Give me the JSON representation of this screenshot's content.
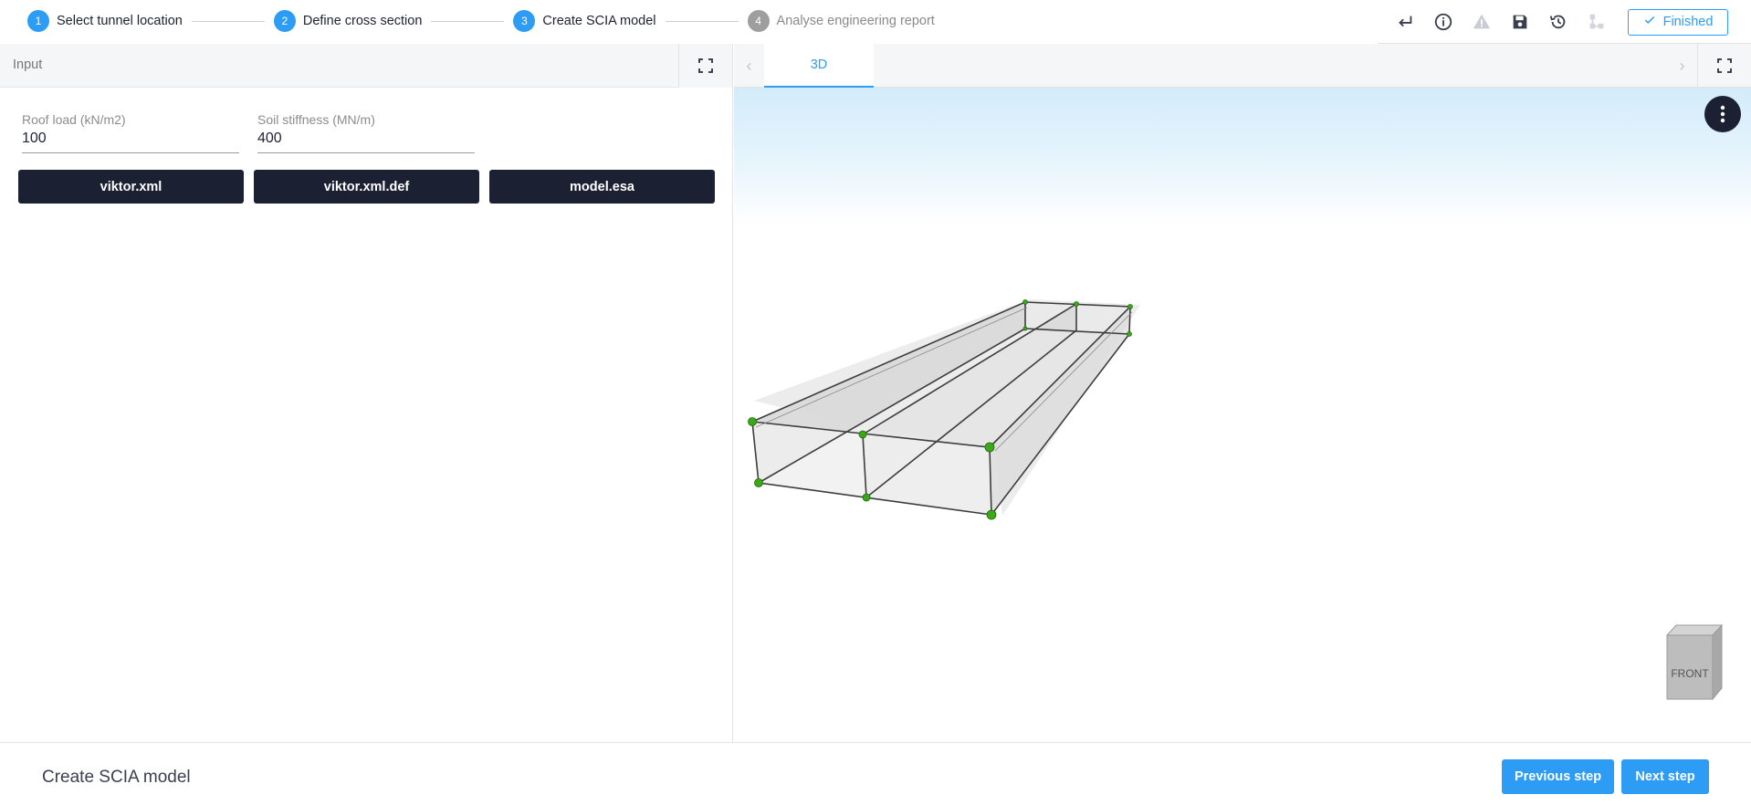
{
  "stepper": {
    "steps": [
      {
        "number": "1",
        "label": "Select tunnel location",
        "state": "done"
      },
      {
        "number": "2",
        "label": "Define cross section",
        "state": "done"
      },
      {
        "number": "3",
        "label": "Create SCIA model",
        "state": "active"
      },
      {
        "number": "4",
        "label": "Analyse engineering report",
        "state": "inactive"
      }
    ]
  },
  "toolbar": {
    "icons": [
      "enter-icon",
      "info-icon",
      "warning-icon",
      "save-icon",
      "history-icon",
      "hierarchy-icon"
    ],
    "finished_label": "Finished"
  },
  "input_panel": {
    "title": "Input",
    "fields": [
      {
        "label": "Roof load (kN/m2)",
        "value": "100"
      },
      {
        "label": "Soil stiffness (MN/m)",
        "value": "400"
      }
    ],
    "download_buttons": [
      "viktor.xml",
      "viktor.xml.def",
      "model.esa"
    ]
  },
  "viewer": {
    "tabs": [
      "3D"
    ],
    "active_tab": "3D",
    "view_cube_label": "FRONT",
    "colors": {
      "accent": "#2d9cf5",
      "dark": "#1c2033",
      "node": "#3aa817"
    }
  },
  "footer": {
    "step_title": "Create SCIA model",
    "previous_label": "Previous step",
    "next_label": "Next step"
  }
}
